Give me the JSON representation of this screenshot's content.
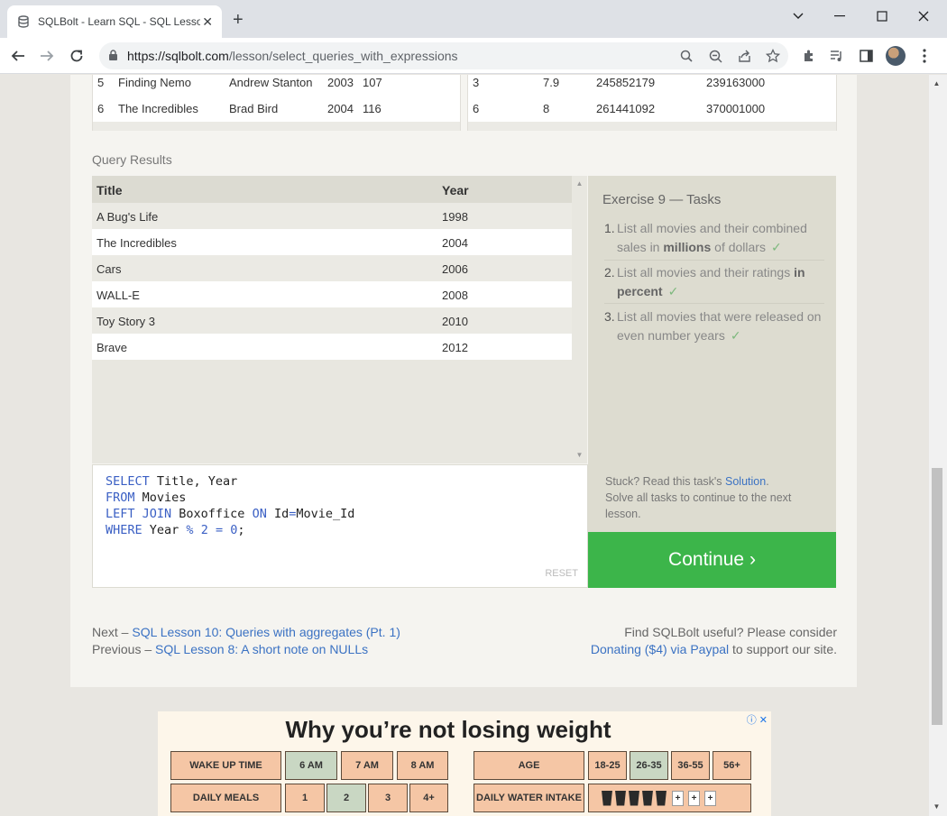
{
  "browser": {
    "tab_title": "SQLBolt - Learn SQL - SQL Lesson",
    "url_host": "https://sqlbolt.com",
    "url_path": "/lesson/select_queries_with_expressions"
  },
  "movies_table": {
    "rows": [
      {
        "id": "5",
        "title": "Finding Nemo",
        "director": "Andrew Stanton",
        "year": "2003",
        "length": "107"
      },
      {
        "id": "6",
        "title": "The Incredibles",
        "director": "Brad Bird",
        "year": "2004",
        "length": "116"
      }
    ]
  },
  "boxoffice_table": {
    "rows": [
      {
        "movie_id": "3",
        "rating": "7.9",
        "domestic": "245852179",
        "international": "239163000"
      },
      {
        "movie_id": "6",
        "rating": "8",
        "domestic": "261441092",
        "international": "370001000"
      }
    ]
  },
  "query_results": {
    "label": "Query Results",
    "headers": [
      "Title",
      "Year"
    ],
    "rows": [
      {
        "title": "A Bug's Life",
        "year": "1998"
      },
      {
        "title": "The Incredibles",
        "year": "2004"
      },
      {
        "title": "Cars",
        "year": "2006"
      },
      {
        "title": "WALL-E",
        "year": "2008"
      },
      {
        "title": "Toy Story 3",
        "year": "2010"
      },
      {
        "title": "Brave",
        "year": "2012"
      }
    ]
  },
  "exercise": {
    "title": "Exercise 9 — Tasks",
    "tasks": [
      {
        "num": "1.",
        "pre": "List all movies and their combined sales in ",
        "bold": "millions",
        "post": " of dollars"
      },
      {
        "num": "2.",
        "pre": "List all movies and their ratings ",
        "bold": "in percent",
        "post": ""
      },
      {
        "num": "3.",
        "pre": "List all movies that were released on even number years",
        "bold": "",
        "post": ""
      }
    ],
    "check": "✓",
    "stuck_pre": "Stuck? Read this task's ",
    "solution_link": "Solution",
    "stuck_post": ".",
    "solve_all": "Solve all tasks to continue to the next lesson."
  },
  "editor": {
    "line1_kw": "SELECT",
    "line1_rest": " Title, Year",
    "line2_kw": "FROM",
    "line2_rest": " Movies",
    "line3_kw": "LEFT JOIN",
    "line3_a": " Boxoffice ",
    "line3_kw2": "ON",
    "line3_b": " Id",
    "line3_eq": "=",
    "line3_c": "Movie_Id",
    "line4_kw": "WHERE",
    "line4_a": " Year ",
    "line4_op": "%",
    "line4_b": " ",
    "line4_num": "2",
    "line4_c": " ",
    "line4_eq": "=",
    "line4_d": " ",
    "line4_zero": "0",
    "line4_end": ";",
    "reset_label": "RESET"
  },
  "continue_label": "Continue ›",
  "footer_nav": {
    "next_prefix": "Next – ",
    "next_link": "SQL Lesson 10: Queries with aggregates (Pt. 1)",
    "prev_prefix": "Previous – ",
    "prev_link": "SQL Lesson 8: A short note on NULLs",
    "support_line1": "Find SQLBolt useful? Please consider",
    "support_link": "Donating ($4) via Paypal",
    "support_tail": " to support our site."
  },
  "ad": {
    "title": "Why you’re not losing weight",
    "wake_label": "WAKE UP TIME",
    "wake_options": [
      "6 AM",
      "7 AM",
      "8 AM"
    ],
    "age_label": "AGE",
    "age_options": [
      "18-25",
      "26-35",
      "36-55",
      "56+"
    ],
    "meals_label": "DAILY MEALS",
    "meals_options": [
      "1",
      "2",
      "3",
      "4+"
    ],
    "water_label": "DAILY WATER INTAKE",
    "plus": "+"
  }
}
